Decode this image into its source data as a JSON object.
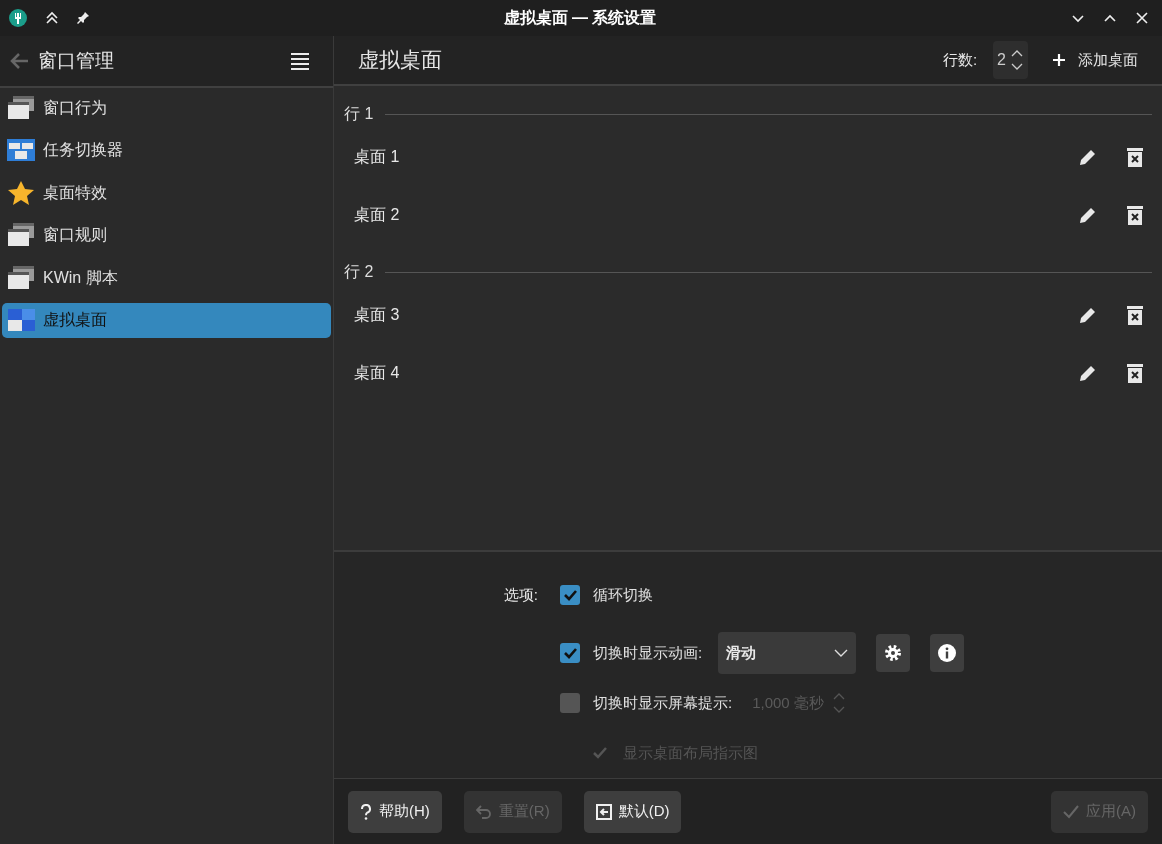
{
  "window": {
    "title": "虚拟桌面 — 系统设置"
  },
  "sidebar": {
    "title": "窗口管理",
    "items": [
      {
        "label": "窗口行为",
        "selected": false
      },
      {
        "label": "任务切换器",
        "selected": false
      },
      {
        "label": "桌面特效",
        "selected": false
      },
      {
        "label": "窗口规则",
        "selected": false
      },
      {
        "label": "KWin 脚本",
        "selected": false
      },
      {
        "label": "虚拟桌面",
        "selected": true
      }
    ]
  },
  "page": {
    "title": "虚拟桌面",
    "rows_label": "行数:",
    "rows_value": "2",
    "add_button": "添加桌面"
  },
  "rows": [
    {
      "label": "行 1",
      "desktops": [
        "桌面 1",
        "桌面 2"
      ]
    },
    {
      "label": "行 2",
      "desktops": [
        "桌面 3",
        "桌面 4"
      ]
    }
  ],
  "options": {
    "label": "选项:",
    "items": [
      {
        "kind": "check",
        "label": "循环切换",
        "checked": true
      },
      {
        "kind": "combo",
        "label": "切换时显示动画:",
        "checked": true,
        "value": "滑动"
      },
      {
        "kind": "spin",
        "label": "切换时显示屏幕提示:",
        "checked": false,
        "value": "1,000 毫秒"
      },
      {
        "kind": "sub",
        "label": "显示桌面布局指示图",
        "checked": true,
        "disabled": true
      }
    ]
  },
  "footer": [
    {
      "kind": "help",
      "label": "帮助(H)",
      "disabled": false
    },
    {
      "kind": "reset",
      "label": "重置(R)",
      "disabled": true
    },
    {
      "kind": "defaults",
      "label": "默认(D)",
      "disabled": false
    },
    {
      "kind": "apply",
      "label": "应用(A)",
      "disabled": true
    }
  ]
}
